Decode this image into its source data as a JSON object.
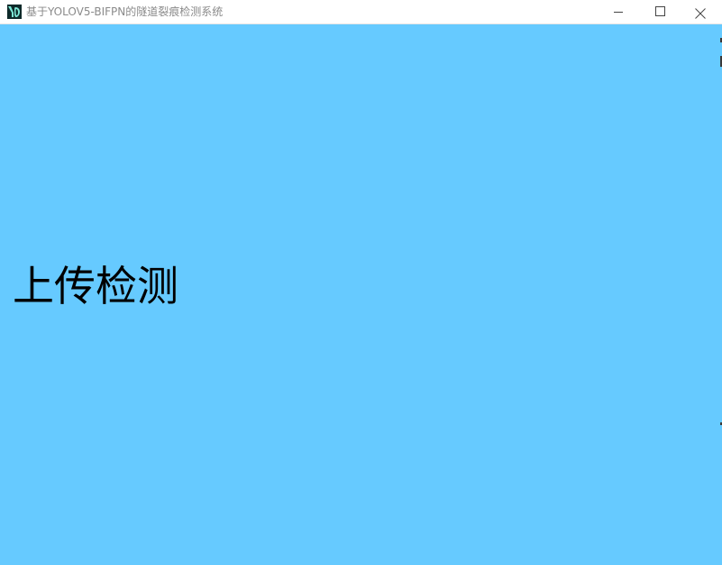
{
  "window": {
    "title": "基于YOLOV5-BIFPN的隧道裂痕检测系统",
    "icon": "yolo-app-icon",
    "controls": {
      "minimize": "minimize-icon",
      "maximize": "maximize-icon",
      "close": "close-icon"
    }
  },
  "main": {
    "upload_detect_label": "上传检测"
  },
  "colors": {
    "client_background": "#66caff",
    "titlebar_background": "#ffffff",
    "title_text": "#8a8a8a",
    "label_text": "#000000"
  }
}
